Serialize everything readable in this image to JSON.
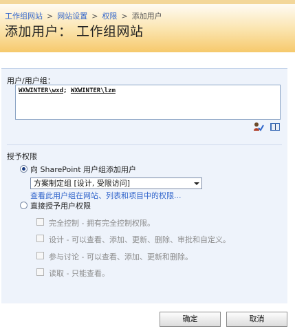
{
  "breadcrumb": {
    "items": [
      "工作组网站",
      "网站设置",
      "权限"
    ],
    "current": "添加用户",
    "separator": ">"
  },
  "page": {
    "title": "添加用户： 工作组网站"
  },
  "users": {
    "label": "用户/用户组：",
    "entry1": "WXWINTER\\wxd",
    "separator": ";",
    "entry2": "WXWINTER\\lzm"
  },
  "grant": {
    "label": "授予权限",
    "sharepoint_option": "向 SharePoint 用户组添加用户",
    "selected_group": "方案制定组 [设计, 受限访问]",
    "view_permissions_link": "查看此用户组在网站、列表和项目中的权限...",
    "direct_option": "直接授予用户权限",
    "permissions": [
      "完全控制 - 拥有完全控制权限。",
      "设计 - 可以查看、添加、更新、删除、审批和自定义。",
      "参与讨论 - 可以查看、添加、更新和删除。",
      "读取 - 只能查看。"
    ]
  },
  "buttons": {
    "ok": "确定",
    "cancel": "取消"
  },
  "colors": {
    "header_bottom": "#f6c96c",
    "panel_bg": "#eef3fb",
    "link": "#3366cc"
  },
  "icons": {
    "check_names": "check-names-icon",
    "address_book": "address-book-icon"
  }
}
